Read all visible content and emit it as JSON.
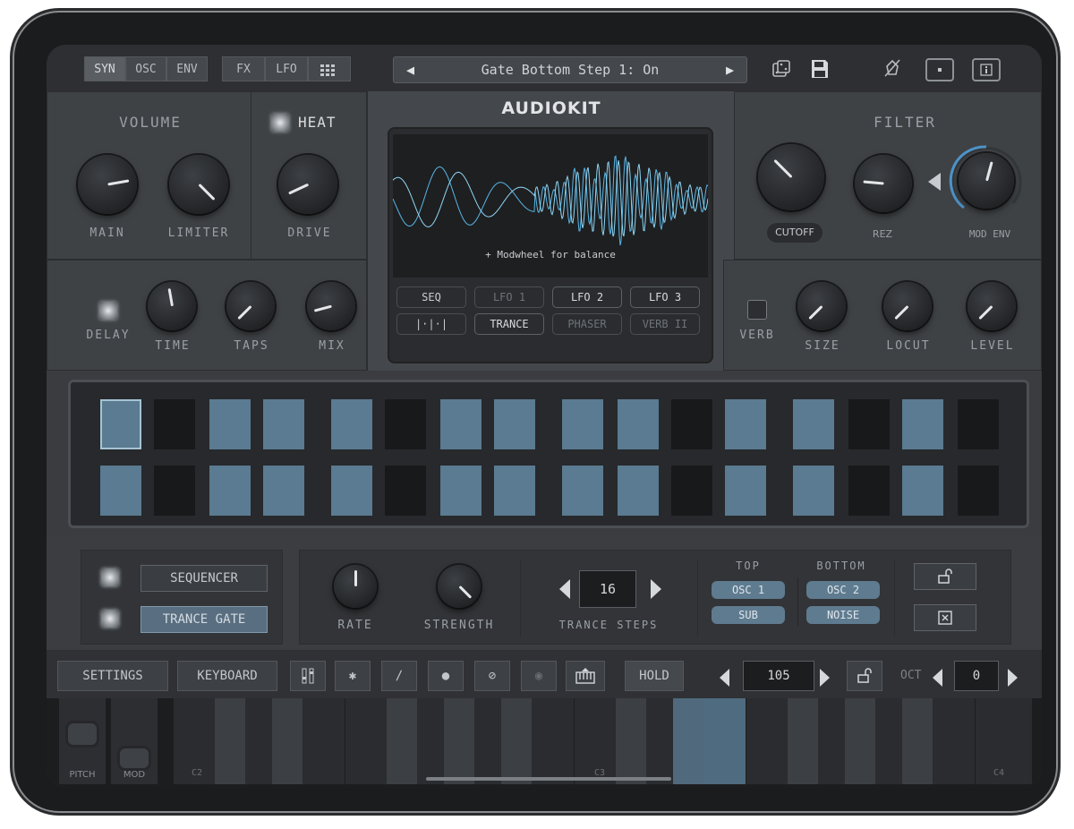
{
  "tabs": [
    "SYN",
    "OSC",
    "ENV",
    "FX",
    "LFO"
  ],
  "grid_tab_icon": "grid-icon",
  "preset": {
    "name": "Gate Bottom Step 1: On",
    "prev_icon": "triangle-left-icon",
    "next_icon": "triangle-right-icon"
  },
  "top_icons": [
    "dice-icon",
    "save-icon",
    "midi-learn-icon",
    "screen-icon",
    "info-icon"
  ],
  "volume": {
    "title": "VOLUME",
    "main_label": "MAIN",
    "limiter_label": "LIMITER",
    "main_value": 0.68,
    "limiter_value": 0.75
  },
  "heat": {
    "title": "HEAT",
    "drive_label": "DRIVE",
    "enabled": true,
    "drive_value": 0.3
  },
  "brand": "AUDIOKIT",
  "display": {
    "caption": "+ Modwheel for balance"
  },
  "display_buttons_row1": [
    "SEQ",
    "LFO 1",
    "LFO 2",
    "LFO 3"
  ],
  "display_buttons_row2": [
    "|·|·|",
    "TRANCE",
    "PHASER",
    "VERB II"
  ],
  "filter": {
    "title": "FILTER",
    "cutoff_label": "CUTOFF",
    "rez_label": "REZ",
    "modenv_label": "MOD ENV",
    "cutoff_value": 0.3,
    "rez_value": 0.25,
    "modenv_value": 0.55
  },
  "delay": {
    "toggle_label": "DELAY",
    "enabled": true,
    "time_label": "TIME",
    "taps_label": "TAPS",
    "mix_label": "MIX",
    "time_value": 0.45,
    "taps_value": 0.25,
    "mix_value": 0.25
  },
  "reverb": {
    "toggle_label": "VERB",
    "enabled": false,
    "size_label": "SIZE",
    "locut_label": "LOCUT",
    "level_label": "LEVEL",
    "size_value": 0.25,
    "locut_value": 0.25,
    "level_value": 0.25
  },
  "sequencer_pads": {
    "top": [
      1,
      0,
      1,
      1,
      1,
      0,
      1,
      1,
      1,
      1,
      0,
      1,
      1,
      0,
      1,
      0
    ],
    "bottom": [
      1,
      0,
      1,
      1,
      1,
      0,
      1,
      1,
      1,
      1,
      0,
      1,
      1,
      0,
      1,
      0
    ],
    "current_step": 1
  },
  "modes": {
    "sequencer_label": "SEQUENCER",
    "trance_gate_label": "TRANCE GATE",
    "active": "TRANCE GATE"
  },
  "trance": {
    "rate_label": "RATE",
    "strength_label": "STRENGTH",
    "rate_value": 0.5,
    "strength_value": 0.78,
    "steps_label": "TRANCE STEPS",
    "steps_value": "16"
  },
  "routing": {
    "top_label": "TOP",
    "bottom_label": "BOTTOM",
    "top_items": [
      "OSC 1",
      "SUB"
    ],
    "bottom_items": [
      "OSC 2",
      "NOISE"
    ]
  },
  "lock_icon": "unlock-icon",
  "clear_icon": "close-box-icon",
  "bottom_bar": {
    "settings_label": "SETTINGS",
    "keyboard_label": "KEYBOARD",
    "hold_label": "HOLD",
    "tempo_value": "105",
    "oct_label": "OCT",
    "oct_value": "0",
    "icons": [
      "mixer-icon",
      "bluetooth-icon",
      "link-icon",
      "midi-icon",
      "panic-icon",
      "record-icon",
      "piano-icon"
    ]
  },
  "keyboard": {
    "labels": [
      "C2",
      "C3",
      "C4"
    ],
    "pitch_label": "PITCH",
    "mod_label": "MOD"
  }
}
